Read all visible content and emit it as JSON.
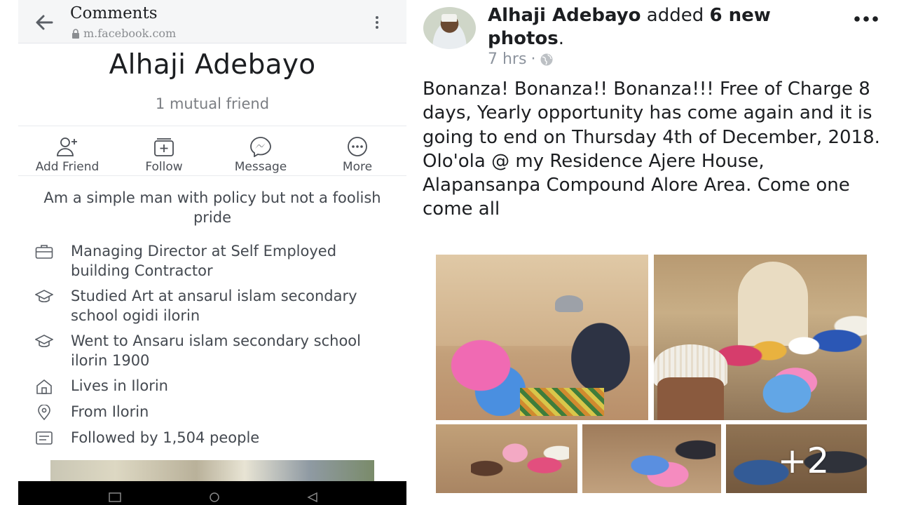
{
  "left": {
    "topbar": {
      "title": "Comments",
      "url": "m.facebook.com"
    },
    "profile": {
      "name": "Alhaji Adebayo",
      "mutual_friends": "1 mutual friend"
    },
    "actions": [
      {
        "label": "Add Friend",
        "icon": "add-friend-icon"
      },
      {
        "label": "Follow",
        "icon": "follow-icon"
      },
      {
        "label": "Message",
        "icon": "messenger-icon"
      },
      {
        "label": "More",
        "icon": "more-icon"
      }
    ],
    "bio": "Am a simple man with policy but not a foolish pride",
    "intro": [
      {
        "icon": "briefcase-icon",
        "text": "Managing Director at Self Employed building Contractor"
      },
      {
        "icon": "graduation-cap-icon",
        "text": "Studied Art at ansarul islam secondary school ogidi ilorin"
      },
      {
        "icon": "graduation-cap-icon",
        "text": "Went to Ansaru islam secondary school ilorin 1900"
      },
      {
        "icon": "home-icon",
        "text": "Lives in Ilorin"
      },
      {
        "icon": "location-pin-icon",
        "text": "From Ilorin"
      },
      {
        "icon": "followers-icon",
        "text": "Followed by 1,504 people"
      }
    ]
  },
  "right": {
    "post": {
      "author": "Alhaji Adebayo",
      "action_text": " added ",
      "photo_count": "6 new photos",
      "period": ".",
      "time": "7 hrs",
      "separator": "·",
      "privacy_icon": "globe-icon",
      "body": "Bonanza! Bonanza!! Bonanza!!! Free of Charge 8 days, Yearly opportunity has come again and it is going to end on Thursday 4th of December, 2018. Olo'ola @ my Residence Ajere House, Alapansanpa Compound Alore Area. Come one come all",
      "more_photos": "+2"
    }
  },
  "colors": {
    "text_primary": "#1c1e21",
    "text_secondary": "#8d949e",
    "topbar_bg": "#f5f6f7",
    "navbar_bg": "#000000"
  }
}
